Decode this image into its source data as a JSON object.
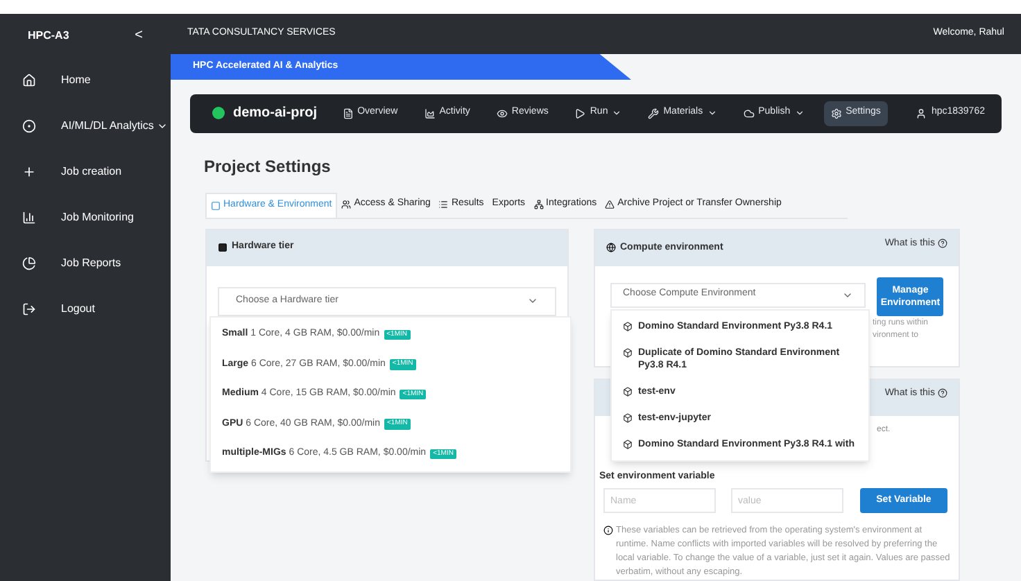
{
  "sidebar": {
    "title": "HPC-A3",
    "collapse": "<",
    "items": [
      {
        "label": "Home",
        "caret": false
      },
      {
        "label": "AI/ML/DL Analytics",
        "caret": true
      },
      {
        "label": "Job creation",
        "caret": false
      },
      {
        "label": "Job Monitoring",
        "caret": false
      },
      {
        "label": "Job Reports",
        "caret": false
      },
      {
        "label": "Logout",
        "caret": false
      }
    ]
  },
  "topbar": {
    "company": "TATA CONSULTANCY SERVICES",
    "welcome": "Welcome, Rahul"
  },
  "banner": "HPC Accelerated AI & Analytics",
  "project_nav": {
    "project": "demo-ai-proj",
    "items": [
      {
        "label": "Overview",
        "menu": false,
        "selected": false
      },
      {
        "label": "Activity",
        "menu": false,
        "selected": false
      },
      {
        "label": "Reviews",
        "menu": false,
        "selected": false
      },
      {
        "label": "Run",
        "menu": true,
        "selected": false
      },
      {
        "label": "Materials",
        "menu": true,
        "selected": false
      },
      {
        "label": "Publish",
        "menu": true,
        "selected": false
      },
      {
        "label": "Settings",
        "menu": false,
        "selected": true
      }
    ],
    "user": "hpc1839762"
  },
  "page_title": "Project Settings",
  "tabs": [
    {
      "label": "Hardware & Environment",
      "selected": true
    },
    {
      "label": "Access & Sharing",
      "selected": false
    },
    {
      "label": "Results",
      "selected": false
    },
    {
      "label": "Exports",
      "selected": false
    },
    {
      "label": "Integrations",
      "selected": false
    },
    {
      "label": "Archive Project or Transfer Ownership",
      "selected": false
    }
  ],
  "hardware": {
    "title": "Hardware tier",
    "placeholder": "Choose a Hardware tier",
    "options": [
      {
        "name": "Small",
        "spec": "1 Core, 4 GB RAM, $0.00/min",
        "badge": "<1MIN"
      },
      {
        "name": "Large",
        "spec": "6 Core, 27 GB RAM, $0.00/min",
        "badge": "<1MIN"
      },
      {
        "name": "Medium",
        "spec": "4 Core, 15 GB RAM, $0.00/min",
        "badge": "<1MIN"
      },
      {
        "name": "GPU",
        "spec": "6 Core, 40 GB RAM, $0.00/min",
        "badge": "<1MIN"
      },
      {
        "name": "multiple-MIGs",
        "spec": "6 Core, 4.5 GB RAM, $0.00/min",
        "badge": "<1MIN"
      }
    ]
  },
  "compute": {
    "title": "Compute environment",
    "help": "What is this",
    "placeholder": "Choose Compute Environment",
    "manage_button": "Manage Environment",
    "behind_text": [
      "ting runs within",
      "vironment to"
    ],
    "options": [
      "Domino Standard Environment Py3.8 R4.1",
      "Duplicate of Domino Standard Environment Py3.8 R4.1",
      "test-env",
      "test-env-jupyter",
      "Domino Standard Environment Py3.8 R4.1 with"
    ]
  },
  "env_vars": {
    "help": "What is this",
    "behind_text": "ect.",
    "label": "Set environment variable",
    "name_placeholder": "Name",
    "value_placeholder": "value",
    "button": "Set Variable",
    "info": "These variables can be retrieved from the operating system's environment at runtime. Name conflicts with imported variables will be resolved by preferring the local variable. To change the value of a variable, just set it again. Values are passed verbatim, without any escaping."
  }
}
